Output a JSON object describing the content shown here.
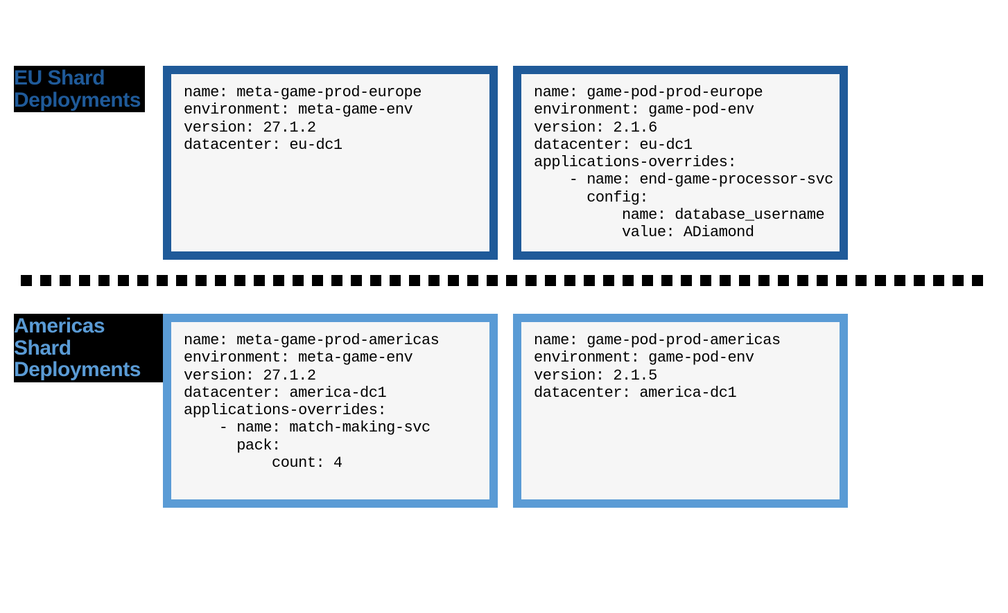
{
  "eu": {
    "label_line1": "EU Shard",
    "label_line2": "Deployments",
    "card1": "name: meta-game-prod-europe\nenvironment: meta-game-env\nversion: 27.1.2\ndatacenter: eu-dc1",
    "card2": "name: game-pod-prod-europe\nenvironment: game-pod-env\nversion: 2.1.6\ndatacenter: eu-dc1\napplications-overrides:\n    - name: end-game-processor-svc\n      config:\n          name: database_username\n          value: ADiamond"
  },
  "am": {
    "label_line1": "Americas Shard",
    "label_line2": "Deployments",
    "card1": "name: meta-game-prod-americas\nenvironment: meta-game-env\nversion: 27.1.2\ndatacenter: america-dc1\napplications-overrides:\n    - name: match-making-svc\n      pack:\n          count: 4",
    "card2": "name: game-pod-prod-americas\nenvironment: game-pod-env\nversion: 2.1.5\ndatacenter: america-dc1"
  }
}
